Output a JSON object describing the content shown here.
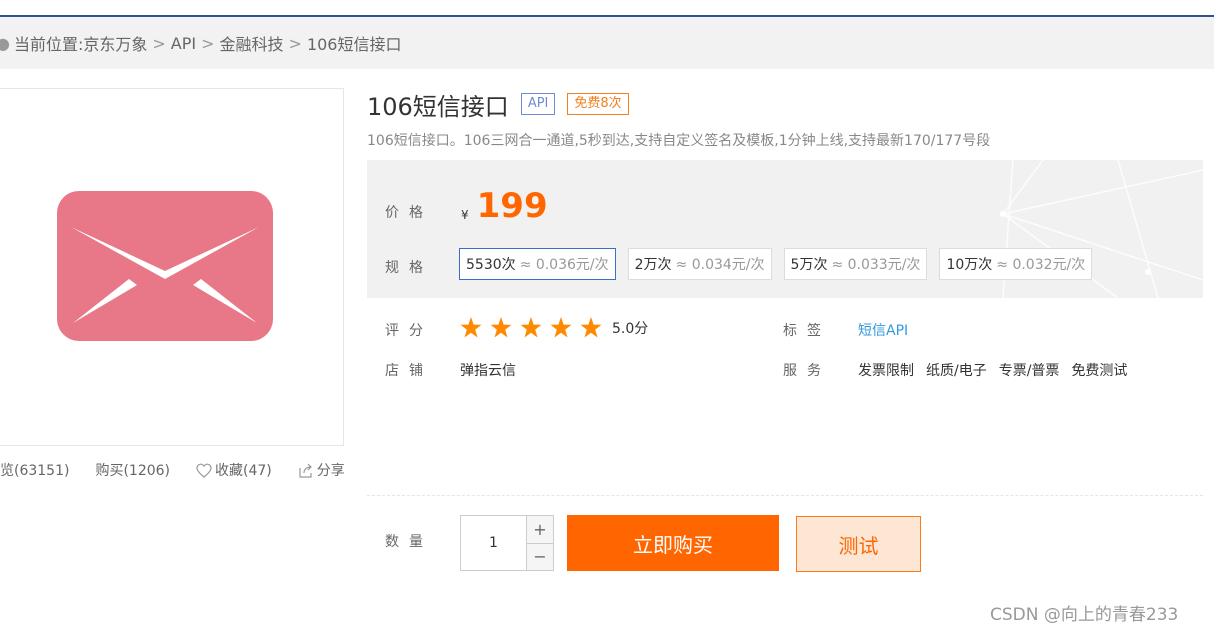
{
  "breadcrumb": {
    "prefix": "当前位置:",
    "items": [
      "京东万象",
      "API",
      "金融科技",
      "106短信接口"
    ],
    "separator": ">"
  },
  "stats": {
    "views": "览(63151)",
    "purchases": "购买(1206)",
    "favorites": "收藏(47)",
    "share": "分享"
  },
  "product": {
    "title": "106短信接口",
    "badge_api": "API",
    "badge_free": "免费8次",
    "description": "106短信接口。106三网合一通道,5秒到达,支持自定义签名及模板,1分钟上线,支持最新170/177号段"
  },
  "price": {
    "label": "价格",
    "currency": "¥",
    "amount": "199"
  },
  "spec": {
    "label": "规格",
    "options": [
      {
        "count": "5530次",
        "unit": "≈ 0.036元/次",
        "selected": true
      },
      {
        "count": "2万次",
        "unit": "≈ 0.034元/次",
        "selected": false
      },
      {
        "count": "5万次",
        "unit": "≈ 0.033元/次",
        "selected": false
      },
      {
        "count": "10万次",
        "unit": "≈ 0.032元/次",
        "selected": false
      }
    ]
  },
  "rating": {
    "label": "评分",
    "stars": 5,
    "score": "5.0分"
  },
  "tags": {
    "label": "标签",
    "value": "短信API"
  },
  "shop": {
    "label": "店铺",
    "name": "弹指云信"
  },
  "service": {
    "label": "服务",
    "items": [
      "发票限制",
      "纸质/电子",
      "专票/普票",
      "免费测试"
    ]
  },
  "quantity": {
    "label": "数量",
    "value": "1",
    "plus": "+",
    "minus": "−"
  },
  "actions": {
    "buy": "立即购买",
    "test": "测试"
  },
  "watermark": "CSDN @向上的青春233",
  "colors": {
    "accent": "#ff6600",
    "icon_bg": "#e87787",
    "link": "#3399dd",
    "api_badge": "#6e8cd7",
    "free_badge": "#f08020",
    "star": "#ff8a00"
  }
}
